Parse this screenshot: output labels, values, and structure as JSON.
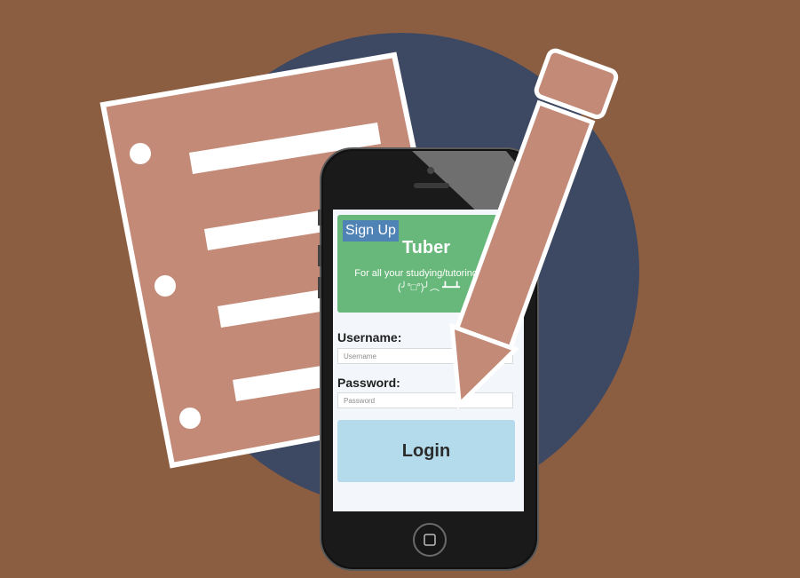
{
  "app": {
    "signup_label": "Sign Up",
    "brand": "Tuber",
    "tagline": "For all your studying/tutoring woes (╯°□°)╯︵ ┻━┻"
  },
  "form": {
    "username_label": "Username:",
    "username_placeholder": "Username",
    "password_label": "Password:",
    "password_placeholder": "Password",
    "login_label": "Login"
  },
  "colors": {
    "background": "#8b5e42",
    "circle": "#3d4863",
    "paper": "#c48a78",
    "banner": "#67b87a",
    "signup": "#4f82b5",
    "login": "#b3dbec"
  },
  "icons": [
    "notepad-illustration",
    "pencil-illustration",
    "smartphone-illustration",
    "home-button-icon"
  ]
}
